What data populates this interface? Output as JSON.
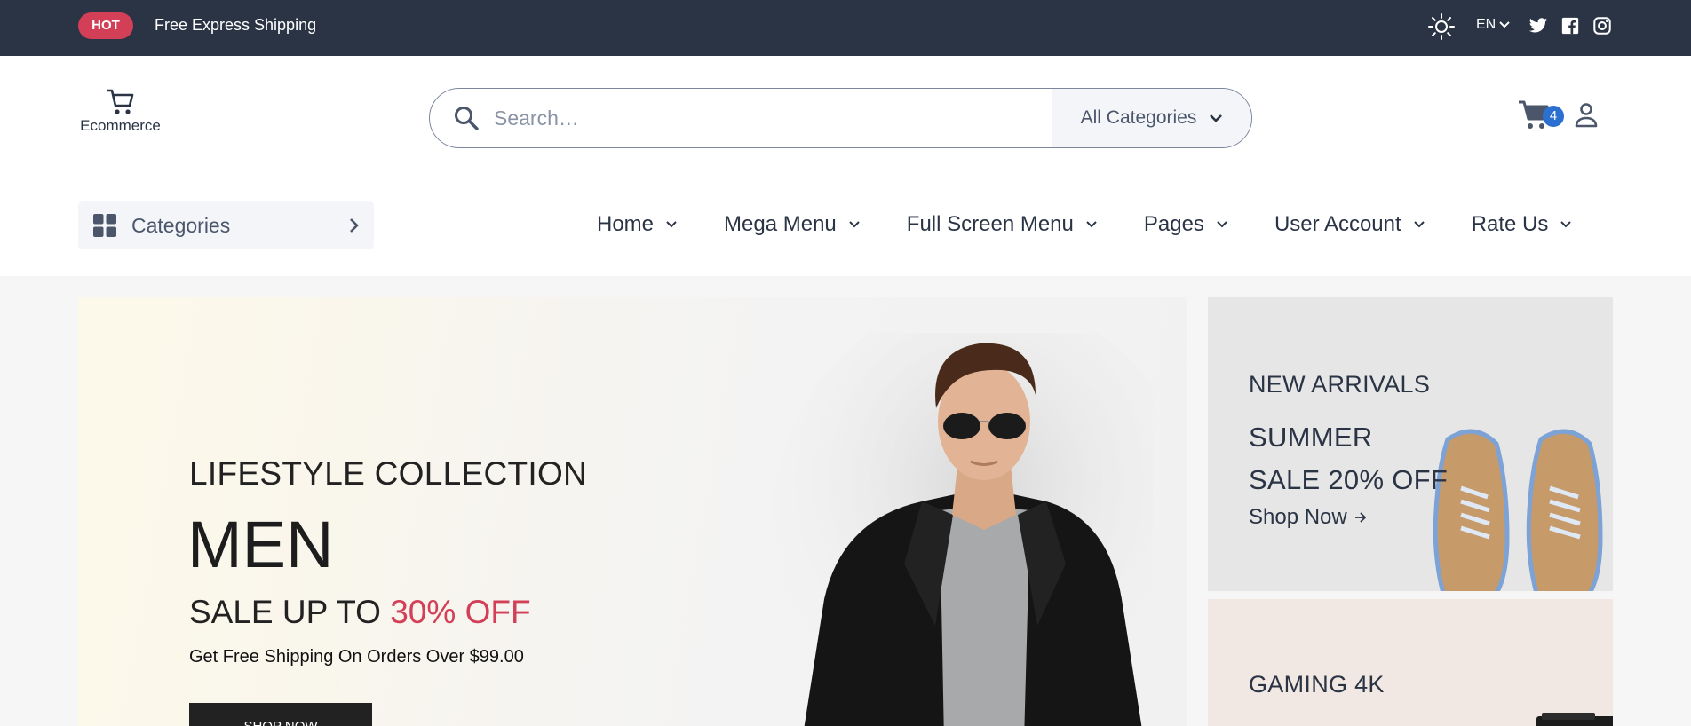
{
  "topbar": {
    "hot_badge": "HOT",
    "shipping_text": "Free Express Shipping",
    "language": "EN",
    "icons": [
      "sun-icon",
      "twitter-icon",
      "facebook-icon",
      "instagram-icon"
    ]
  },
  "header": {
    "logo_text": "Ecommerce",
    "search": {
      "placeholder": "Search…",
      "value": "",
      "category": "All Categories"
    },
    "cart_count": "4"
  },
  "nav": {
    "categories_label": "Categories",
    "items": [
      {
        "label": "Home"
      },
      {
        "label": "Mega Menu"
      },
      {
        "label": "Full Screen Menu"
      },
      {
        "label": "Pages"
      },
      {
        "label": "User Account"
      },
      {
        "label": "Rate Us"
      }
    ]
  },
  "hero": {
    "subtitle": "LIFESTYLE COLLECTION",
    "title": "MEN",
    "sale_prefix": "SALE UP TO",
    "sale_highlight": "30% OFF",
    "description": "Get Free Shipping On Orders Over $99.00",
    "button": "SHOP NOW"
  },
  "promo_cards": [
    {
      "tag": "NEW ARRIVALS",
      "line1": "SUMMER",
      "line2": "SALE 20% OFF",
      "link": "Shop Now"
    },
    {
      "tag": "GAMING 4K"
    }
  ],
  "colors": {
    "dark": "#2b3445",
    "accent": "#d23f57",
    "badge": "#2b6fd0"
  }
}
